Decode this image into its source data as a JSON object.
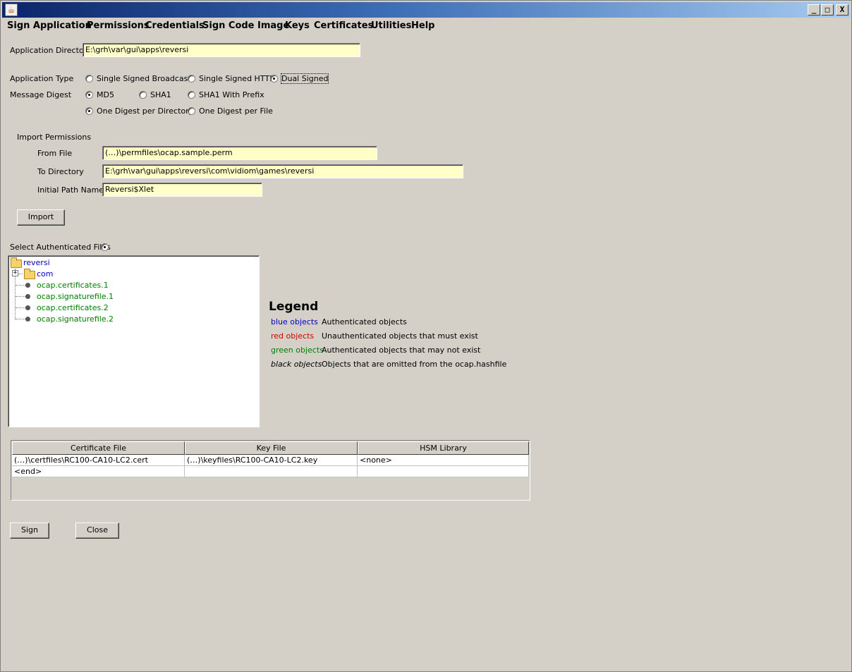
{
  "window": {
    "minimize": "_",
    "maximize": "□",
    "close": "X"
  },
  "menu": [
    "Sign Application",
    "Permissions",
    "Credentials",
    "Sign Code Image",
    "Keys",
    "Certificates",
    "Utilities",
    "Help"
  ],
  "app_dir": {
    "label": "Application Directory",
    "value": "E:\\grh\\var\\gui\\apps\\reversi"
  },
  "app_type": {
    "label": "Application Type",
    "options": [
      "Single Signed Broadcast",
      "Single Signed HTTP",
      "Dual Signed"
    ],
    "selected": "Dual Signed"
  },
  "message_digest": {
    "label": "Message Digest",
    "options": [
      "MD5",
      "SHA1",
      "SHA1 With Prefix"
    ],
    "selected": "MD5"
  },
  "digest_mode": {
    "options": [
      "One Digest per Directory",
      "One Digest per File"
    ],
    "selected": "One Digest per Directory"
  },
  "import_permissions": {
    "heading": "Import Permissions",
    "from_file_label": "From File",
    "from_file": "(…)\\permfiles\\ocap.sample.perm",
    "to_dir_label": "To Directory",
    "to_dir": "E:\\grh\\var\\gui\\apps\\reversi\\com\\vidiom\\games\\reversi",
    "initial_path_label": "Initial Path Name",
    "initial_path": "Reversi$Xlet",
    "import_button": "Import"
  },
  "select_auth": {
    "label": "Select Authenticated Files"
  },
  "tree": {
    "root": "reversi",
    "folder": "com",
    "files": [
      "ocap.certificates.1",
      "ocap.signaturefile.1",
      "ocap.certificates.2",
      "ocap.signaturefile.2"
    ]
  },
  "legend": {
    "title": "Legend",
    "items": [
      {
        "key": "blue objects",
        "desc": "Authenticated objects",
        "color": "#0000c0"
      },
      {
        "key": "red objects",
        "desc": "Unauthenticated objects that must exist",
        "color": "#d00000"
      },
      {
        "key": "green objects",
        "desc": "Authenticated objects that may not exist",
        "color": "#008000"
      },
      {
        "key": "black objects",
        "desc": "Objects that are omitted from the ocap.hashfile",
        "color": "#000000"
      }
    ]
  },
  "cert_table": {
    "headers": [
      "Certificate File",
      "Key File",
      "HSM Library"
    ],
    "rows": [
      [
        "(…)\\certfiles\\RC100-CA10-LC2.cert",
        "(…)\\keyfiles\\RC100-CA10-LC2.key",
        "<none>"
      ],
      [
        "<end>",
        "",
        ""
      ]
    ]
  },
  "buttons": {
    "sign": "Sign",
    "close": "Close"
  },
  "colors": {
    "tree_blue": "#0000c0",
    "tree_green": "#008000",
    "field_bg": "#ffffc8"
  }
}
